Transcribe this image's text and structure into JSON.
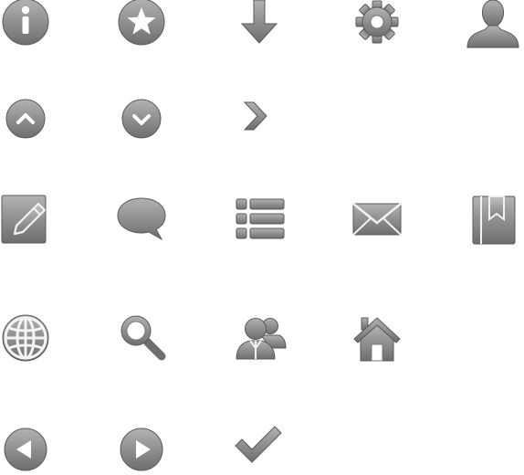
{
  "icon_sheet": {
    "background": "#ffffff",
    "icon_color_light": "#a8a8a8",
    "icon_color_dark": "#6e6e6e",
    "icon_stroke": "#5a5a5a",
    "rows": [
      [
        "info-icon",
        "star-icon",
        "download-arrow-icon",
        "gear-icon",
        "user-icon"
      ],
      [
        "chevron-up-circle-icon",
        "chevron-down-circle-icon",
        "chevron-right-icon"
      ],
      [
        "compose-icon",
        "speech-bubble-icon",
        "list-icon",
        "mail-icon",
        "bookmark-book-icon"
      ],
      [
        "globe-icon",
        "search-icon",
        "people-icon",
        "home-icon"
      ],
      [
        "arrow-left-circle-icon",
        "arrow-right-circle-icon",
        "checkmark-icon"
      ]
    ]
  }
}
